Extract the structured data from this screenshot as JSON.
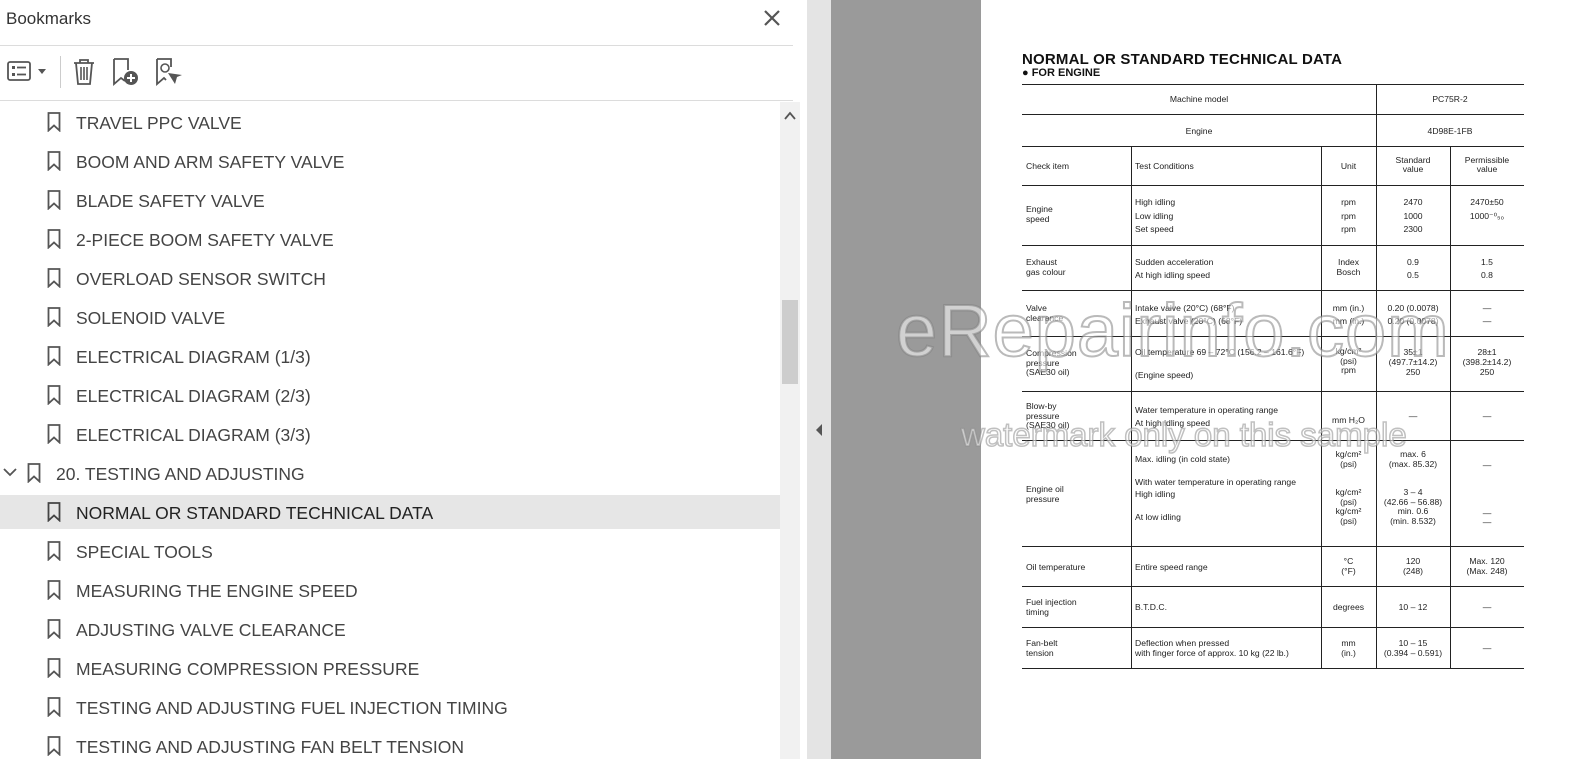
{
  "panel": {
    "title": "Bookmarks"
  },
  "bookmarks": [
    {
      "label": "TRAVEL PPC VALVE",
      "level": 1
    },
    {
      "label": "BOOM AND ARM SAFETY VALVE",
      "level": 1
    },
    {
      "label": "BLADE SAFETY VALVE",
      "level": 1
    },
    {
      "label": "2-PIECE BOOM SAFETY VALVE",
      "level": 1
    },
    {
      "label": "OVERLOAD SENSOR SWITCH",
      "level": 1
    },
    {
      "label": "SOLENOID VALVE",
      "level": 1
    },
    {
      "label": "ELECTRICAL DIAGRAM (1/3)",
      "level": 1
    },
    {
      "label": "ELECTRICAL DIAGRAM (2/3)",
      "level": 1
    },
    {
      "label": "ELECTRICAL DIAGRAM (3/3)",
      "level": 1
    },
    {
      "label": "20. TESTING AND ADJUSTING",
      "level": 0,
      "expanded": true
    },
    {
      "label": "NORMAL OR STANDARD TECHNICAL DATA",
      "level": 1,
      "selected": true
    },
    {
      "label": "SPECIAL TOOLS",
      "level": 1
    },
    {
      "label": "MEASURING THE ENGINE SPEED",
      "level": 1
    },
    {
      "label": "ADJUSTING VALVE CLEARANCE",
      "level": 1
    },
    {
      "label": "MEASURING COMPRESSION PRESSURE",
      "level": 1
    },
    {
      "label": "TESTING AND ADJUSTING FUEL INJECTION TIMING",
      "level": 1
    },
    {
      "label": "TESTING AND ADJUSTING FAN BELT TENSION",
      "level": 1
    }
  ],
  "doc": {
    "title": "NORMAL OR STANDARD TECHNICAL DATA",
    "subtitle": "● FOR ENGINE",
    "watermark": "eRepairinfo.com",
    "watermark2": "watermark only on this sample",
    "header": {
      "machine_model_label": "Machine model",
      "machine_model": "PC75R-2",
      "engine_label": "Engine",
      "engine": "4D98E-1FB",
      "check_item": "Check item",
      "test_conditions": "Test Conditions",
      "unit": "Unit",
      "standard": "Standard\nvalue",
      "permissible": "Permissible\nvalue"
    },
    "rows": [
      {
        "item": "Engine\nspeed",
        "cond": "High idling\nLow idling\nSet speed",
        "unit": "rpm\nrpm\nrpm",
        "std": "2470\n1000\n2300",
        "perm": "2470±50\n1000⁻⁰₅₀\n"
      },
      {
        "item": "Exhaust\ngas colour",
        "cond": "Sudden acceleration\nAt high idling speed",
        "unit": "Index\nBosch",
        "std": "0.9\n0.5",
        "perm": "1.5\n0.8"
      },
      {
        "item": "Valve\nclearance",
        "cond": "Intake valve (20°C) (68°F)\nExhaust valve (20°C) (68°F)",
        "unit": "mm (in.)\nmm (in.)",
        "std": "0.20 (0.0078)\n0.20 (0.0078)",
        "perm": "—\n—"
      },
      {
        "item": "Compression\npressure\n(SAE30 oil)",
        "cond": "Oil temperature 69 – 72°C (156.2 – 161.6°F)\n\n(Engine speed)",
        "unit": "kg/cm²\n(psi)\nrpm",
        "std": "35±1\n(497.7±14.2)\n250",
        "perm": "28±1\n(398.2±14.2)\n250"
      },
      {
        "item": "Blow-by\npressure\n(SAE30 oil)",
        "cond": "Water temperature in operating range\nAt high idling speed",
        "unit": "mm H₂O",
        "std": "—",
        "perm": "—"
      },
      {
        "item": "Engine oil\npressure",
        "cond": "Max. idling (in cold state)\n\nWith water temperature in operating range\nHigh idling\n\nAt low idling",
        "unit": "kg/cm²\n(psi)\n\n\nkg/cm²\n(psi)\nkg/cm²\n(psi)",
        "std": "max. 6\n(max. 85.32)\n\n\n3 – 4\n(42.66 – 56.88)\nmin. 0.6\n(min. 8.532)",
        "perm": "—\n\n\n\n\n—\n—\n"
      },
      {
        "item": "Oil temperature",
        "cond": "Entire speed range",
        "unit": "°C\n(°F)",
        "std": "120\n(248)",
        "perm": "Max. 120\n(Max. 248)"
      },
      {
        "item": "Fuel injection\ntiming",
        "cond": "B.T.D.C.",
        "unit": "degrees",
        "std": "10 – 12",
        "perm": "—"
      },
      {
        "item": "Fan-belt\ntension",
        "cond": "Deflection when pressed\nwith finger force of approx. 10 kg (22 lb.)",
        "unit": "mm\n(in.)",
        "std": "10 – 15\n(0.394 – 0.591)",
        "perm": "—"
      }
    ]
  }
}
